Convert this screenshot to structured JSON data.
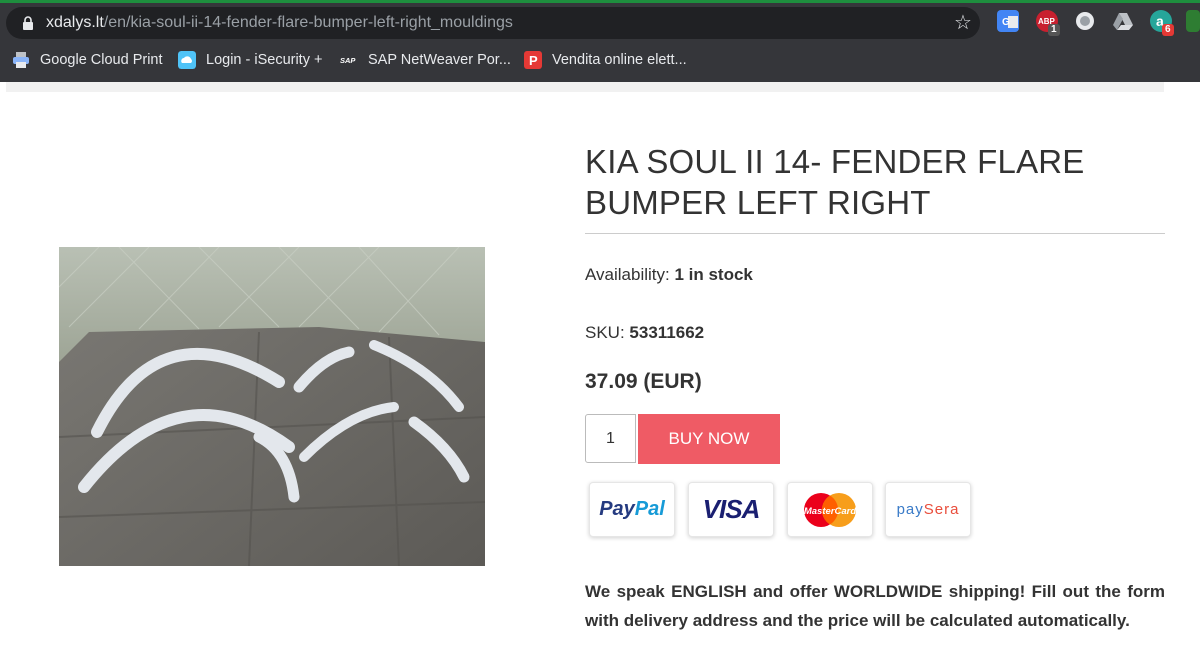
{
  "browser": {
    "url_host": "xdalys.lt",
    "url_path": "/en/kia-soul-ii-14-fender-flare-bumper-left-right_mouldings",
    "star_icon": "star-icon",
    "extensions": [
      {
        "name": "google-translate-icon",
        "badge": ""
      },
      {
        "name": "adblock-icon",
        "label": "ABP",
        "badge": "1"
      },
      {
        "name": "circle-extension-icon",
        "badge": ""
      },
      {
        "name": "google-drive-icon",
        "badge": ""
      },
      {
        "name": "green-extension-icon",
        "badge": "6"
      }
    ],
    "bookmarks": [
      {
        "label": "Google Cloud Print",
        "icon": "printer-icon"
      },
      {
        "label": "Login - iSecurity +",
        "icon": "cloud-icon"
      },
      {
        "label": "SAP NetWeaver Por...",
        "icon": "sap-icon",
        "icon_text": "SAP"
      },
      {
        "label": "Vendita online elett...",
        "icon": "p-icon",
        "icon_text": "P"
      }
    ]
  },
  "product": {
    "title": "KIA SOUL II 14- FENDER FLARE BUMPER LEFT RIGHT",
    "availability_label": "Availability:",
    "availability_value": "1 in stock",
    "sku_label": "SKU:",
    "sku_value": "53311662",
    "price": "37.09 (EUR)",
    "quantity": "1",
    "buy_label": "BUY NOW",
    "image_alt": "fender flare mouldings on pavement"
  },
  "payments": [
    {
      "name": "paypal",
      "label_a": "Pay",
      "label_b": "Pal"
    },
    {
      "name": "visa",
      "label": "VISA"
    },
    {
      "name": "mastercard",
      "label": "MasterCard"
    },
    {
      "name": "paysera",
      "label_a": "pay",
      "label_b": "Sera"
    }
  ],
  "info_text": "We speak ENGLISH and offer WORLDWIDE shipping! Fill out the form with delivery address and the price will be calculated automatically.",
  "colors": {
    "buy_button": "#ef5b65",
    "chrome_bg": "#35363a",
    "text": "#333333"
  }
}
